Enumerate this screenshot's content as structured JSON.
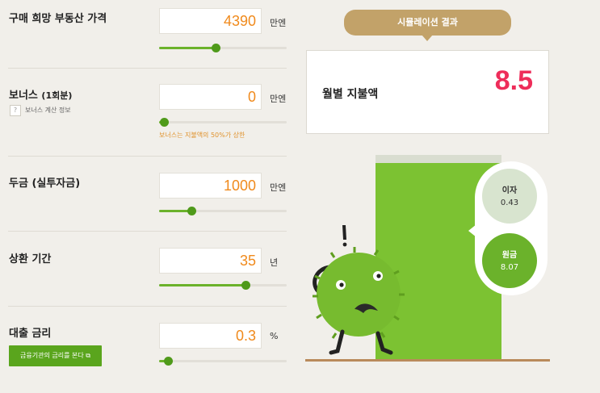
{
  "form": {
    "price": {
      "label": "구매 희망 부동산 가격",
      "value": "4390",
      "unit": "만엔",
      "level": 0.44
    },
    "bonus": {
      "label": "보너스",
      "label_sub": "(1회분)",
      "value": "0",
      "unit": "만엔",
      "level": 0.0,
      "hint_icon": "?",
      "hint_label": "보너스 계산 정보",
      "note": "보너스는 지불액의 50%가 상한"
    },
    "down_payment": {
      "label": "두금 (실투자금)",
      "value": "1000",
      "unit": "만엔",
      "level": 0.25
    },
    "term": {
      "label": "상환 기간",
      "value": "35",
      "unit": "년",
      "level": 0.68
    },
    "rate": {
      "label": "대출 금리",
      "value": "0.3",
      "unit": "%",
      "level": 0.07,
      "button_label": "금융기관의 금리를 본다 ⧉"
    }
  },
  "result": {
    "banner": "시뮬레이션 결과",
    "monthly_label": "월별 지불액",
    "monthly_value": "8.5",
    "interest": {
      "label": "이자",
      "value": "0.43"
    },
    "principal": {
      "label": "원금",
      "value": "8.07"
    }
  },
  "colors": {
    "accent_orange": "#f08a1c",
    "result_red": "#ee2d5a",
    "green": "#6bb22b",
    "tan": "#c2a269"
  },
  "icons": [
    "question-icon",
    "external-link-icon",
    "mascot-illustration"
  ]
}
